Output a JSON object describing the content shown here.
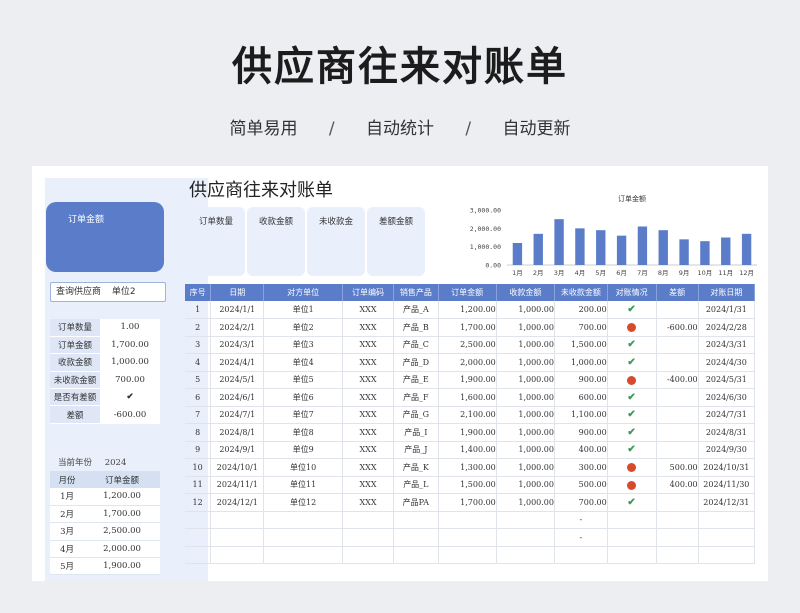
{
  "hero": {
    "title": "供应商往来对账单",
    "tags": [
      "简单易用",
      "自动统计",
      "自动更新"
    ],
    "separator": "/"
  },
  "sheet_title": "供应商往来对账单",
  "kpi_big_label": "订单金额",
  "supplier_query": {
    "label": "查询供应商",
    "value": "单位2"
  },
  "summary": [
    {
      "key": "订单数量",
      "value": "1.00",
      "type": "text"
    },
    {
      "key": "订单金额",
      "value": "1,700.00",
      "type": "text"
    },
    {
      "key": "收款金额",
      "value": "1,000.00",
      "type": "text"
    },
    {
      "key": "未收款金额",
      "value": "700.00",
      "type": "text"
    },
    {
      "key": "是否有差额",
      "value": "✔",
      "type": "check"
    },
    {
      "key": "差额",
      "value": "-600.00",
      "type": "red"
    }
  ],
  "year": {
    "label": "当前年份",
    "value": "2024"
  },
  "month_table": {
    "headers": [
      "月份",
      "订单金额"
    ],
    "rows": [
      [
        "1月",
        "1,200.00"
      ],
      [
        "2月",
        "1,700.00"
      ],
      [
        "3月",
        "2,500.00"
      ],
      [
        "4月",
        "2,000.00"
      ],
      [
        "5月",
        "1,900.00"
      ]
    ]
  },
  "kpi_cards": [
    "订单数量",
    "收款金额",
    "未收款金",
    "差额金额"
  ],
  "colors": {
    "accent": "#5b7cc9",
    "panel": "#e9f0fb",
    "status_red": "#d54b2b",
    "status_green": "#3d9a58"
  },
  "chart_data": {
    "type": "bar",
    "title": "订单金额",
    "categories": [
      "1月",
      "2月",
      "3月",
      "4月",
      "5月",
      "6月",
      "7月",
      "8月",
      "9月",
      "10月",
      "11月",
      "12月"
    ],
    "values": [
      1200,
      1700,
      2500,
      2000,
      1900,
      1600,
      2100,
      1900,
      1400,
      1300,
      1500,
      1700
    ],
    "yticks": [
      "0.00",
      "1,000.00",
      "2,000.00",
      "3,000.00"
    ],
    "ylim": [
      0,
      3000
    ],
    "color": "#5b7cc9"
  },
  "table": {
    "headers": [
      "序号",
      "日期",
      "对方单位",
      "订单编码",
      "销售产品",
      "订单金额",
      "收款金额",
      "未收款金额",
      "对账情况",
      "差额",
      "对账日期"
    ],
    "rows": [
      [
        "1",
        "2024/1/1",
        "单位1",
        "XXX",
        "产品_A",
        "1,200.00",
        "1,000.00",
        "200.00",
        "check",
        "",
        "2024/1/31"
      ],
      [
        "2",
        "2024/2/1",
        "单位2",
        "XXX",
        "产品_B",
        "1,700.00",
        "1,000.00",
        "700.00",
        "dot",
        "-600.00",
        "2024/2/28"
      ],
      [
        "3",
        "2024/3/1",
        "单位3",
        "XXX",
        "产品_C",
        "2,500.00",
        "1,000.00",
        "1,500.00",
        "check",
        "",
        "2024/3/31"
      ],
      [
        "4",
        "2024/4/1",
        "单位4",
        "XXX",
        "产品_D",
        "2,000.00",
        "1,000.00",
        "1,000.00",
        "check",
        "",
        "2024/4/30"
      ],
      [
        "5",
        "2024/5/1",
        "单位5",
        "XXX",
        "产品_E",
        "1,900.00",
        "1,000.00",
        "900.00",
        "dot",
        "-400.00",
        "2024/5/31"
      ],
      [
        "6",
        "2024/6/1",
        "单位6",
        "XXX",
        "产品_F",
        "1,600.00",
        "1,000.00",
        "600.00",
        "check",
        "",
        "2024/6/30"
      ],
      [
        "7",
        "2024/7/1",
        "单位7",
        "XXX",
        "产品_G",
        "2,100.00",
        "1,000.00",
        "1,100.00",
        "check",
        "",
        "2024/7/31"
      ],
      [
        "8",
        "2024/8/1",
        "单位8",
        "XXX",
        "产品_I",
        "1,900.00",
        "1,000.00",
        "900.00",
        "check",
        "",
        "2024/8/31"
      ],
      [
        "9",
        "2024/9/1",
        "单位9",
        "XXX",
        "产品_J",
        "1,400.00",
        "1,000.00",
        "400.00",
        "check",
        "",
        "2024/9/30"
      ],
      [
        "10",
        "2024/10/1",
        "单位10",
        "XXX",
        "产品_K",
        "1,300.00",
        "1,000.00",
        "300.00",
        "dot",
        "500.00",
        "2024/10/31"
      ],
      [
        "11",
        "2024/11/1",
        "单位11",
        "XXX",
        "产品_L",
        "1,500.00",
        "1,000.00",
        "500.00",
        "dot",
        "400.00",
        "2024/11/30"
      ],
      [
        "12",
        "2024/12/1",
        "单位12",
        "XXX",
        "产品PA",
        "1,700.00",
        "1,000.00",
        "700.00",
        "check",
        "",
        "2024/12/31"
      ],
      [
        "",
        "",
        "",
        "",
        "",
        "",
        "",
        "-",
        "",
        "",
        ""
      ],
      [
        "",
        "",
        "",
        "",
        "",
        "",
        "",
        "-",
        "",
        "",
        ""
      ],
      [
        "",
        "",
        "",
        "",
        "",
        "",
        "",
        "",
        "",
        "",
        ""
      ]
    ]
  }
}
